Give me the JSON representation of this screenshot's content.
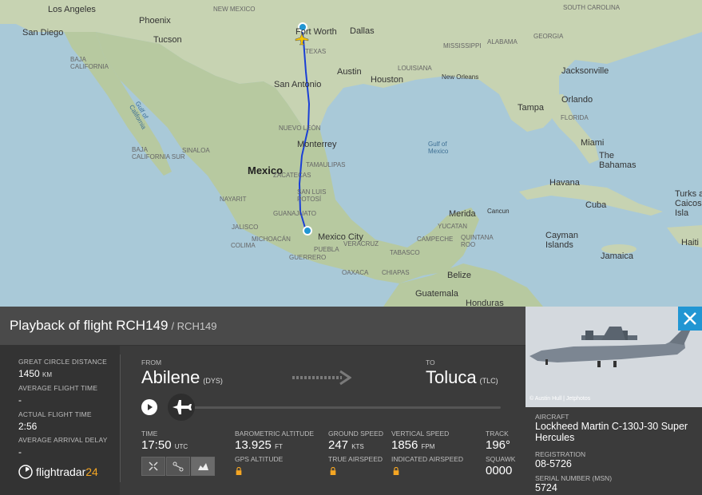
{
  "map": {
    "labels": {
      "los_angeles": "Los Angeles",
      "san_diego": "San Diego",
      "phoenix": "Phoenix",
      "tucson": "Tucson",
      "new_mexico": "NEW MEXICO",
      "baja_california": "BAJA\nCALIFORNIA",
      "fort_worth": "Fort Worth",
      "dallas": "Dallas",
      "texas": "TEXAS",
      "austin": "Austin",
      "houston": "Houston",
      "san_antonio": "San Antonio",
      "louisiana": "LOUISIANA",
      "new_orleans": "New Orleans",
      "mississippi": "MISSISSIPPI",
      "alabama": "ALABAMA",
      "georgia": "GEORGIA",
      "south_carolina": "SOUTH CAROLINA",
      "jacksonville": "Jacksonville",
      "tampa": "Tampa",
      "orlando": "Orlando",
      "florida": "FLORIDA",
      "miami": "Miami",
      "the_bahamas": "The\nBahamas",
      "gulf_of_california": "Gulf of\nCalifornia",
      "baja_california_sur": "BAJA\nCALIFORNIA SUR",
      "sinaloa": "SINALOA",
      "mexico": "Mexico",
      "nuevo_leon": "NUEVO LEÓN",
      "monterrey": "Monterrey",
      "tamaulipas": "TAMAULIPAS",
      "gulf_of_mexico": "Gulf of\nMexico",
      "havana": "Havana",
      "cuba": "Cuba",
      "turks_caicos": "Turks a\nCaicos\nIsla",
      "nayarit": "NAYARIT",
      "san_luis_potosi": "SAN LUIS\nPOTOSÍ",
      "zacatecas": "ZACATECAS",
      "guanajuato": "GUANAJUATO",
      "merida": "Merida",
      "cancun": "Cancun",
      "yucatan": "YUCATAN",
      "jalisco": "JALISCO",
      "michoacan": "MICHOACÁN",
      "mexico_city": "Mexico City",
      "campeche": "CAMPECHE",
      "quintana_roo": "QUINTANA\nROO",
      "cayman_islands": "Cayman\nIslands",
      "haiti": "Haiti",
      "colima": "COLIMA",
      "guerrero": "GUERRERO",
      "puebla": "PUEBLA",
      "veracruz": "VERACRUZ",
      "tabasco": "TABASCO",
      "belize": "Belize",
      "jamaica": "Jamaica",
      "oaxaca": "OAXACA",
      "chiapas": "CHIAPAS",
      "guatemala": "Guatemala",
      "honduras": "Honduras"
    }
  },
  "panel": {
    "title": "Playback of flight RCH149",
    "subtitle": "/ RCH149",
    "stats": {
      "gc_label": "GREAT CIRCLE DISTANCE",
      "gc_value": "1450",
      "gc_unit": "KM",
      "avg_time_label": "AVERAGE FLIGHT TIME",
      "avg_time_value": "-",
      "actual_label": "ACTUAL FLIGHT TIME",
      "actual_value": "2:56",
      "arrival_label": "AVERAGE ARRIVAL DELAY",
      "arrival_value": "-"
    },
    "logo": {
      "text": "flightradar",
      "suffix": "24"
    },
    "route": {
      "from_label": "FROM",
      "from_city": "Abilene",
      "from_code": "(DYS)",
      "to_label": "TO",
      "to_city": "Toluca",
      "to_code": "(TLC)"
    },
    "data": {
      "time_label": "TIME",
      "time_value": "17:50",
      "time_unit": "UTC",
      "baro_label": "BAROMETRIC ALTITUDE",
      "baro_value": "13.925",
      "baro_unit": "FT",
      "gps_label": "GPS ALTITUDE",
      "gs_label": "GROUND SPEED",
      "gs_value": "247",
      "gs_unit": "KTS",
      "tas_label": "TRUE AIRSPEED",
      "vs_label": "VERTICAL SPEED",
      "vs_value": "1856",
      "vs_unit": "FPM",
      "ias_label": "INDICATED AIRSPEED",
      "track_label": "TRACK",
      "track_value": "196°",
      "squawk_label": "SQUAWK",
      "squawk_value": "0000"
    }
  },
  "aircraft": {
    "photo_credit": "© Austin Hull | Jetphotos",
    "aircraft_label": "AIRCRAFT",
    "aircraft_value": "Lockheed Martin C-130J-30 Super Hercules",
    "registration_label": "REGISTRATION",
    "registration_value": "08-5726",
    "serial_label": "SERIAL NUMBER (MSN)",
    "serial_value": "5724"
  },
  "colors": {
    "accent": "#2196d3",
    "route": "#1a3fd6",
    "logo_accent": "#f5a623",
    "lock": "#f5a623"
  }
}
